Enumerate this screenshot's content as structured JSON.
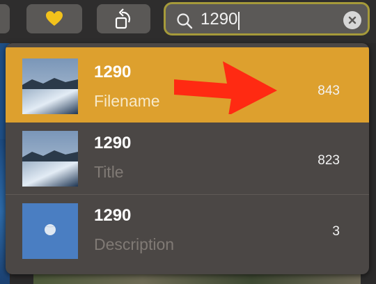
{
  "toolbar": {
    "favorite_icon": "heart-icon",
    "rotate_icon": "rotate-icon"
  },
  "search": {
    "value": "1290",
    "search_icon": "search-icon",
    "clear_icon": "clear-icon"
  },
  "results": [
    {
      "title": "1290",
      "match_field": "Filename",
      "count": "843",
      "thumbnail": "lake-mountain-photo",
      "selected": true
    },
    {
      "title": "1290",
      "match_field": "Title",
      "count": "823",
      "thumbnail": "lake-mountain-photo",
      "selected": false
    },
    {
      "title": "1290",
      "match_field": "Description",
      "count": "3",
      "thumbnail": "moon-sky-photo",
      "selected": false
    }
  ],
  "annotation": {
    "arrow_color": "#ff2a12"
  },
  "colors": {
    "highlight": "#dda02e",
    "search_border": "#a59a3a",
    "heart": "#f2c21b"
  }
}
